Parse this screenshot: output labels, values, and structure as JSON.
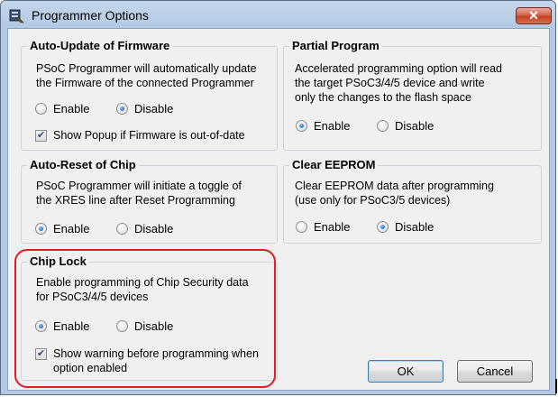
{
  "window": {
    "title": "Programmer Options",
    "close_label": "✕"
  },
  "groups": {
    "auto_update": {
      "title": "Auto-Update of Firmware",
      "description": [
        "PSoC Programmer will automatically update",
        "the Firmware of the connected Programmer"
      ],
      "enable_label": "Enable",
      "disable_label": "Disable",
      "selected": "Disable",
      "checkbox_label": "Show Popup if Firmware is out-of-date",
      "checkbox_checked": true
    },
    "partial_program": {
      "title": "Partial Program",
      "description": [
        "Accelerated programming option will read",
        "the target PSoC3/4/5 device and write",
        "only the changes to the flash space"
      ],
      "enable_label": "Enable",
      "disable_label": "Disable",
      "selected": "Enable"
    },
    "auto_reset": {
      "title": "Auto-Reset of Chip",
      "description": [
        "PSoC Programmer will initiate a toggle of",
        "the XRES line after Reset Programming"
      ],
      "enable_label": "Enable",
      "disable_label": "Disable",
      "selected": "Enable"
    },
    "clear_eeprom": {
      "title": "Clear EEPROM",
      "description": [
        "Clear EEPROM data after programming",
        "(use only for PSoC3/5 devices)"
      ],
      "enable_label": "Enable",
      "disable_label": "Disable",
      "selected": "Disable"
    },
    "chip_lock": {
      "title": "Chip Lock",
      "description": [
        "Enable programming of Chip Security data",
        "for PSoC3/4/5 devices"
      ],
      "enable_label": "Enable",
      "disable_label": "Disable",
      "selected": "Enable",
      "checkbox_label": [
        "Show warning before programming when",
        "option enabled"
      ],
      "checkbox_checked": true
    }
  },
  "buttons": {
    "ok": "OK",
    "cancel": "Cancel"
  },
  "colors": {
    "highlight": "#e31b23",
    "title_bar": "#b3c9e4",
    "close_button": "#c2401f"
  }
}
